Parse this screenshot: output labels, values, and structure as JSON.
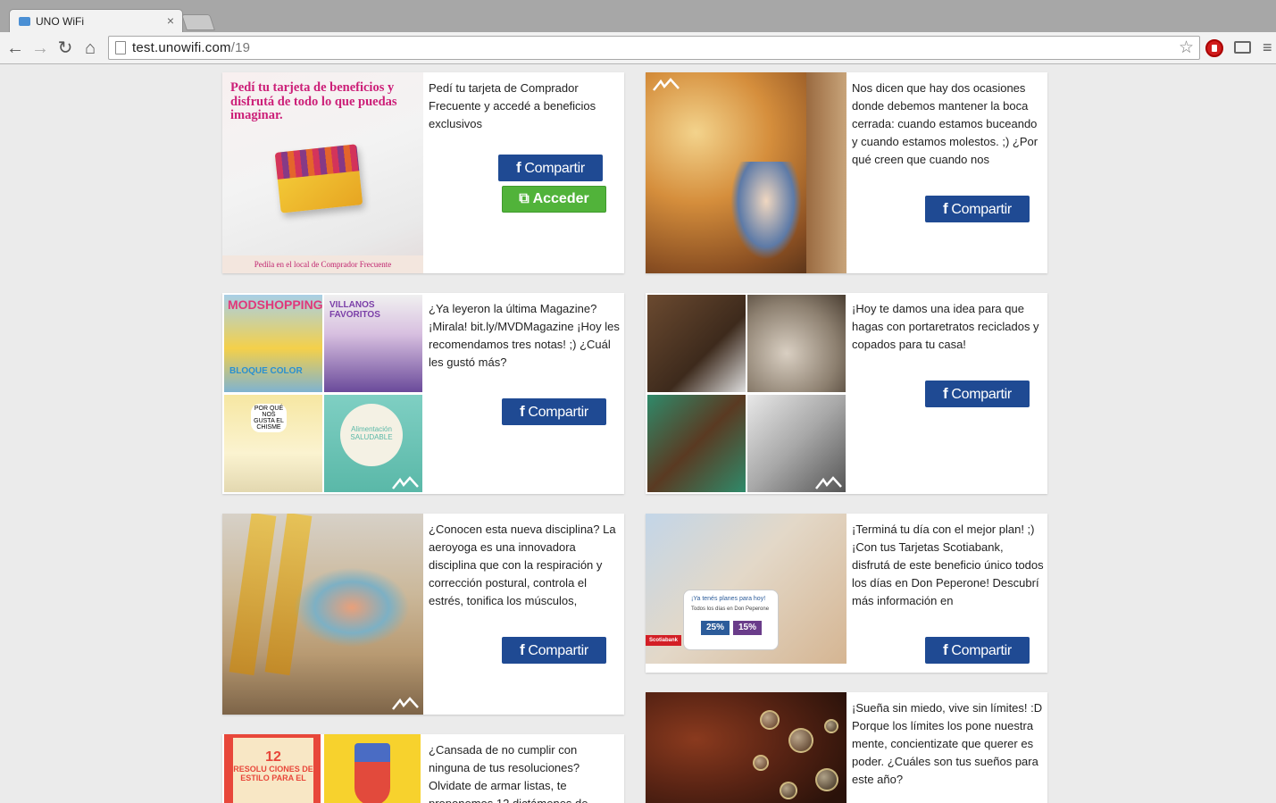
{
  "browser": {
    "tab_title": "UNO WiFi",
    "tab_close": "×",
    "url_host": "test.unowifi.com",
    "url_path": "/19",
    "icons": [
      "back-icon",
      "forward-icon",
      "reload-icon",
      "home-icon",
      "page-icon",
      "star-icon",
      "adblock-icon",
      "cast-icon",
      "menu-icon"
    ]
  },
  "brand_colors": {
    "facebook_button": "#1f4a93",
    "access_button": "#51b33a"
  },
  "cards": [
    {
      "description": "Pedí tu tarjeta de Comprador Frecuente y accedé a beneficios exclusivos",
      "share_label": "Compartir",
      "access_label": "Acceder",
      "image_headline": "Pedí tu tarjeta de beneficios y disfrutá de todo lo que puedas imaginar.",
      "image_footer": "Pedila en el local de Comprador Frecuente"
    },
    {
      "description": "Nos dicen que hay dos ocasiones donde debemos mantener la boca cerrada: cuando estamos buceando y cuando estamos molestos. ;) ¿Por qué creen que cuando nos",
      "share_label": "Compartir"
    },
    {
      "description": "¿Ya leyeron la última Magazine? ¡Mirala! bit.ly/MVDMagazine ¡Hoy les recomendamos tres notas! ;) ¿Cuál les gustó más?",
      "share_label": "Compartir",
      "image_labels": [
        "MODSHOPPING",
        "VILLANOS FAVORITOS",
        "BLOQUE COLOR",
        "POR QUÉ NOS GUSTA EL CHISME",
        "Alimentación SALUDABLE"
      ]
    },
    {
      "description": "¡Hoy te damos una idea para que hagas con portaretratos reciclados y copados para tu casa!",
      "share_label": "Compartir"
    },
    {
      "description": "¿Conocen esta nueva disciplina? La aeroyoga es una innovadora disciplina que con la respiración y corrección postural, controla el estrés, tonifica los músculos,",
      "share_label": "Compartir"
    },
    {
      "description": "¡Terminá tu día con el mejor plan! ;) ¡Con tus Tarjetas Scotiabank, disfrutá de este beneficio único todos los días en Don Peperone! Descubrí más información en",
      "share_label": "Compartir",
      "promo": {
        "headline": "¡Ya tenés planes para hoy!",
        "sub": "Todos los días en Don Peperone",
        "discount_1": "25%",
        "discount_2": "15%",
        "bank": "Scotiabank"
      }
    },
    {
      "description": "¿Cansada de no cumplir con ninguna de tus resoluciones? Olvidate de armar listas, te proponemos 12 dictámenes de",
      "image_number": "12",
      "image_text": "RESOLU CIONES DE ESTILO PARA EL"
    },
    {
      "description": "¡Sueña sin miedo, vive sin límites! :D Porque los límites los pone nuestra mente, concientizate que querer es poder. ¿Cuáles son tus sueños para este año?"
    }
  ]
}
